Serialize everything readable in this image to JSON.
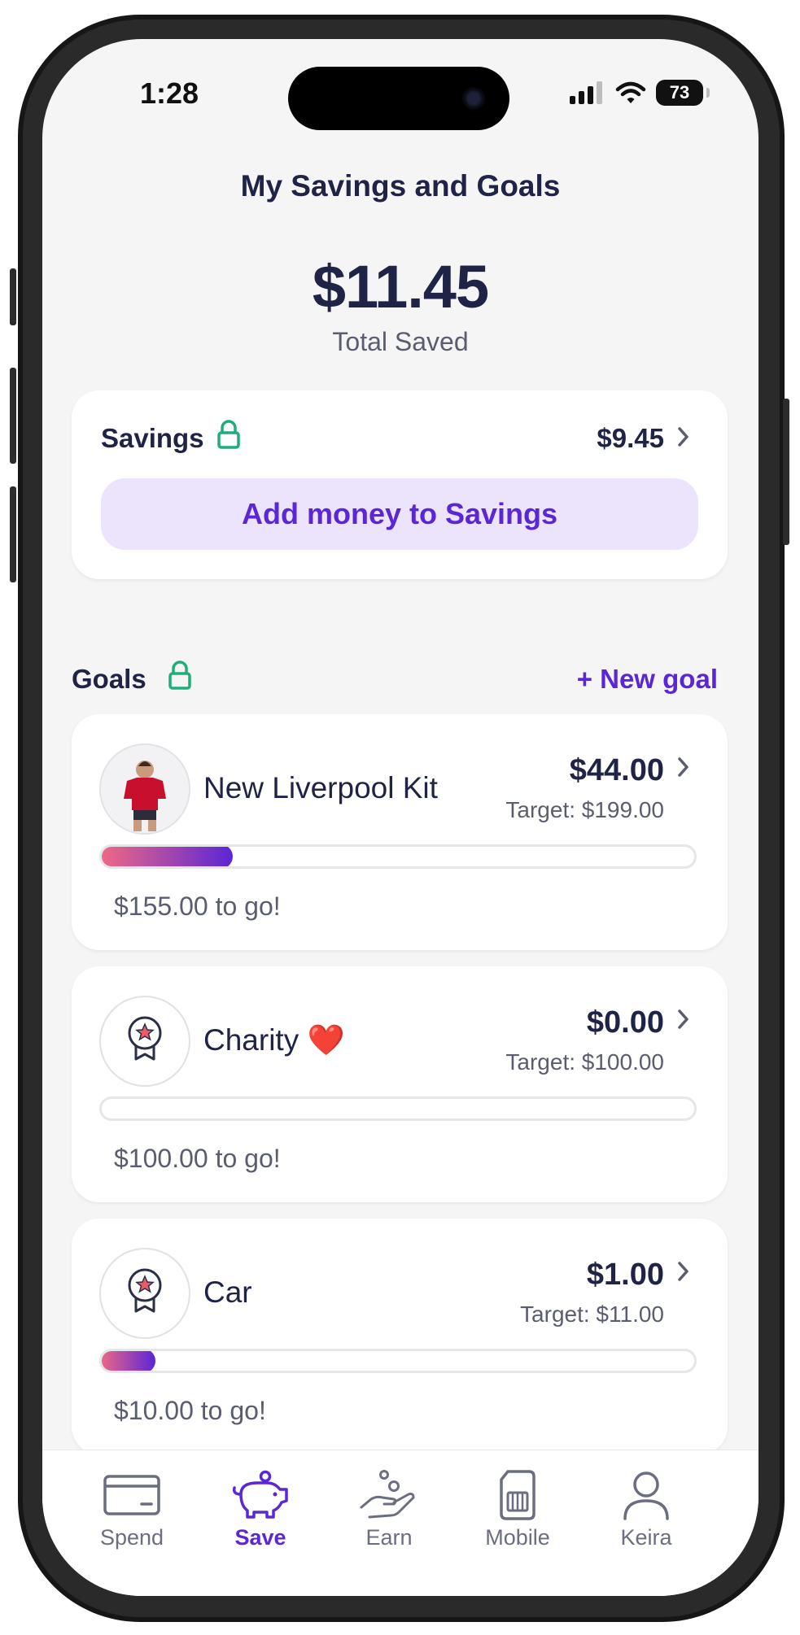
{
  "status_bar": {
    "time": "1:28",
    "battery": "73"
  },
  "header": {
    "title": "My Savings and Goals"
  },
  "summary": {
    "total_amount": "$11.45",
    "total_label": "Total Saved"
  },
  "savings": {
    "label": "Savings",
    "amount": "$9.45",
    "add_button_label": "Add money to Savings"
  },
  "goals_section": {
    "label": "Goals",
    "new_goal_label": "+ New goal"
  },
  "goals": [
    {
      "name": "New Liverpool Kit",
      "amount": "$44.00",
      "target": "Target: $199.00",
      "to_go": "$155.00 to go!",
      "progress": 0.221,
      "icon": "liverpool-kit-photo"
    },
    {
      "name": "Charity ❤️",
      "amount": "$0.00",
      "target": "Target: $100.00",
      "to_go": "$100.00 to go!",
      "progress": 0,
      "icon": "award-ribbon-icon"
    },
    {
      "name": "Car",
      "amount": "$1.00",
      "target": "Target: $11.00",
      "to_go": "$10.00 to go!",
      "progress": 0.091,
      "icon": "award-ribbon-icon"
    }
  ],
  "tabs": [
    {
      "label": "Spend",
      "icon": "card-icon",
      "active": false
    },
    {
      "label": "Save",
      "icon": "piggy-bank-icon",
      "active": true
    },
    {
      "label": "Earn",
      "icon": "hand-coins-icon",
      "active": false
    },
    {
      "label": "Mobile",
      "icon": "sim-card-icon",
      "active": false
    },
    {
      "label": "Keira",
      "icon": "person-icon",
      "active": false
    }
  ],
  "colors": {
    "accent": "#5b26d6",
    "accent_soft": "#ebe4fc",
    "lock_green": "#1fae7a",
    "text_dark": "#1f2447",
    "progress_start": "#f06a82",
    "progress_end": "#5b26d6"
  }
}
